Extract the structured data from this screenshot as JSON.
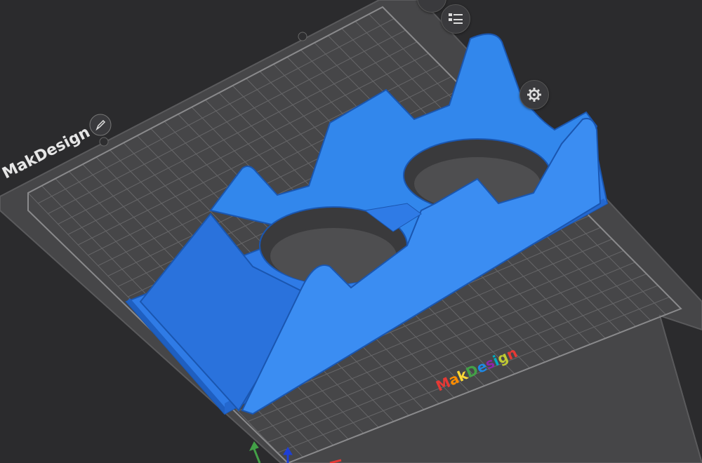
{
  "plate": {
    "name": "MakDesign",
    "edit_icon": "pencil-icon",
    "logo_text": "MakDesign",
    "logo_colors": [
      "#e53935",
      "#fb8c00",
      "#fdd835",
      "#43a047",
      "#1e88e5",
      "#8e24aa",
      "#00acc1",
      "#c0ca33",
      "#e53935"
    ]
  },
  "toolbar": {
    "list_icon": "list-view-icon",
    "settings_icon": "gear-icon"
  },
  "colors": {
    "background": "#2b2b2d",
    "plate": "#4a4a4c",
    "grid": "#6c6c6e",
    "model": "#2f7be6",
    "model_shade": "#1f5fc0",
    "model_light": "#3b8df2"
  },
  "axes": {
    "x_color": "#43a047",
    "y_color": "#1e3fd6",
    "z_color": "#e53935"
  }
}
